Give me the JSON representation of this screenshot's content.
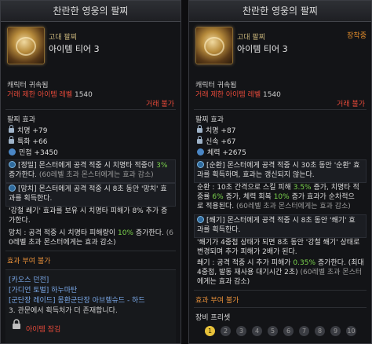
{
  "left": {
    "title": "찬란한 영웅의 팔찌",
    "grade": "고대 팔찌",
    "tier": "아이템 티어 3",
    "bound": "캐릭터 귀속됨",
    "trade_limit_label": "거래 제한 아이템 레벨",
    "trade_limit_value": "1540",
    "trade_no": "거래 불가",
    "effect_title": "팔찌 효과",
    "stats": [
      {
        "label": "치명 +79"
      },
      {
        "label": "특화 +66"
      },
      {
        "label": "민첩 +3450"
      }
    ],
    "effects": [
      {
        "line1": "[정밀] 몬스터에게 공격 적중 시 치명타 적중이 ",
        "hl1": "3%",
        "line2": "증가한다. ",
        "gray2": "(60레벨 초과 몬스터에게는 효과 감소)"
      },
      {
        "line1": "[망치] 몬스터에게 공격 적중 시 8초 동안 '망치' 효",
        "line2": "과를 획득한다."
      },
      {
        "line1": "'강철 쐐기' 효과를 보유 시 치명타 피해가 8% 추가 증",
        "line2": "가한다."
      },
      {
        "line1": "망치 : 공격 적중 시 치명타 피해량이 ",
        "hl1": "10%",
        "line1b": " 증가한다. ",
        "gray1": "(6",
        "line2": "0레벨 초과 몬스터에게는 효과 감소)"
      }
    ],
    "grant": "효과 부여 불가",
    "sources": [
      "[카오스 던전]",
      "[가디언 토벌] 하누마탄",
      "[군단장 레이드] 몽환군단장 아브렐슈드 - 하드",
      "3. 관문에서 획득처가 더 존재합니다."
    ],
    "lock_label": "아이템 잠김"
  },
  "right": {
    "title": "찬란한 영웅의 팔찌",
    "grade": "고대 팔찌",
    "tier": "아이템 티어 3",
    "equipped": "장착중",
    "bound": "캐릭터 귀속됨",
    "trade_limit_label": "거래 제한 아이템 레벨",
    "trade_limit_value": "1540",
    "trade_no": "거래 불가",
    "effect_title": "팔찌 효과",
    "stats": [
      {
        "label": "치명 +87"
      },
      {
        "label": "신속 +67"
      },
      {
        "label": "체력 +2675"
      }
    ],
    "effects": [
      {
        "line1": "[순환] 몬스터에게 공격 적중 시 30초 동안 '순환' 효",
        "line2": "과를 획득하며, 효과는 갱신되지 않는다."
      },
      {
        "line1": "순환 : 10초 간격으로 스킬 피해 ",
        "hl1": "3.5%",
        "line1b": " 증가, 치명타 적",
        "line2": "중률 ",
        "hl2": "6%",
        "line2b": " 증가, 체력 회복 ",
        "hl3": "10%",
        "line2c": " 증가 효과가 순차적으",
        "line3": "로 적용된다. ",
        "gray3": "(60레벨 초과 몬스터에게는 효과 감소)"
      },
      {
        "line1": "[쐐기] 몬스터에게 공격 적중 시 8초 동안 '쐐기' 효",
        "line2": "과를 획득한다."
      },
      {
        "line1": "'쐐기가 4중첩 상태가 되면 8초 동안 '강철 쐐기' 상태로",
        "line2": "변경되며 추가 피해가 2배가 된다."
      },
      {
        "line1": "쐐기 : 공격 적중 시 추가 피해가 ",
        "hl1": "0.35%",
        "line1b": " 증가한다. (최대",
        "line2": "4중첩, 발동 재사용 대기시간 2초) ",
        "gray2": "(60레벨 초과 몬스터",
        "line3": "에게는 효과 감소)"
      }
    ],
    "grant": "효과 부여 불가",
    "equip_set": "장비 프리셋",
    "presets": [
      "1",
      "2",
      "3",
      "4",
      "5",
      "6",
      "7",
      "8",
      "9",
      "10"
    ]
  }
}
